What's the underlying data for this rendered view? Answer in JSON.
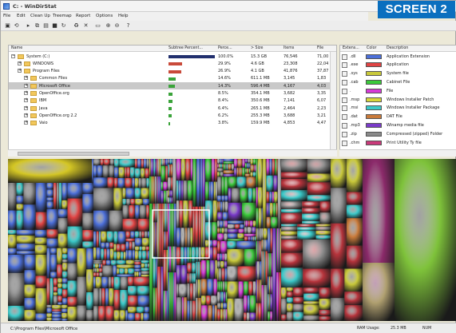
{
  "title": "C: - WinDirStat",
  "badge": "SCREEN 2",
  "menu": [
    "File",
    "Edit",
    "Clean Up",
    "Treemap",
    "Report",
    "Options",
    "Help"
  ],
  "tree": {
    "headers": [
      "Name",
      "Subtree Percent...",
      "Perce...",
      "> Size",
      "Items",
      "File"
    ],
    "rows": [
      {
        "name": "System (C:)",
        "pct": "",
        "perc": "100.0%",
        "size": "15.3 GB",
        "items": "76,546",
        "files": "71,00",
        "level": 0,
        "fill": 1.0,
        "color": "#22306e",
        "selected": false
      },
      {
        "name": "WINDOWS",
        "pct": "",
        "perc": "29.9%",
        "size": "4.6 GB",
        "items": "23,308",
        "files": "22,04",
        "level": 1,
        "fill": 0.3,
        "color": "#c94a3a",
        "selected": false
      },
      {
        "name": "Program Files",
        "pct": "",
        "perc": "26.9%",
        "size": "4.1 GB",
        "items": "41,876",
        "files": "37,87",
        "level": 1,
        "fill": 0.27,
        "color": "#c94a3a",
        "selected": false
      },
      {
        "name": "Common Files",
        "pct": "",
        "perc": "14.6%",
        "size": "611.1 MB",
        "items": "3,145",
        "files": "1,83",
        "level": 2,
        "fill": 0.15,
        "color": "#3aa33a",
        "selected": false
      },
      {
        "name": "Microsoft Office",
        "pct": "",
        "perc": "14.3%",
        "size": "596.4 MB",
        "items": "4,167",
        "files": "4,03",
        "level": 2,
        "fill": 0.14,
        "color": "#3aa33a",
        "selected": true
      },
      {
        "name": "OpenOffice.org",
        "pct": "",
        "perc": "8.5%",
        "size": "354.1 MB",
        "items": "3,682",
        "files": "3,35",
        "level": 2,
        "fill": 0.085,
        "color": "#3aa33a",
        "selected": false
      },
      {
        "name": "IBM",
        "pct": "",
        "perc": "8.4%",
        "size": "350.6 MB",
        "items": "7,141",
        "files": "6,07",
        "level": 2,
        "fill": 0.084,
        "color": "#3aa33a",
        "selected": false
      },
      {
        "name": "Java",
        "pct": "",
        "perc": "6.4%",
        "size": "265.1 MB",
        "items": "2,464",
        "files": "2,23",
        "level": 2,
        "fill": 0.064,
        "color": "#3aa33a",
        "selected": false
      },
      {
        "name": "OpenOffice.org 2.2",
        "pct": "",
        "perc": "6.2%",
        "size": "255.3 MB",
        "items": "3,688",
        "files": "3,21",
        "level": 2,
        "fill": 0.062,
        "color": "#3aa33a",
        "selected": false
      },
      {
        "name": "Vaio",
        "pct": "",
        "perc": "3.8%",
        "size": "159.9 MB",
        "items": "4,853",
        "files": "4,47",
        "level": 2,
        "fill": 0.038,
        "color": "#3aa33a",
        "selected": false
      }
    ]
  },
  "extensions": {
    "headers": [
      "Extens...",
      "Color",
      "Description"
    ],
    "rows": [
      {
        "ext": ".dll",
        "color": "#4c6fd9",
        "desc": "Application Extension"
      },
      {
        "ext": ".exe",
        "color": "#e04343",
        "desc": "Application"
      },
      {
        "ext": ".sys",
        "color": "#c9c93a",
        "desc": "System file"
      },
      {
        "ext": ".cab",
        "color": "#3ac93a",
        "desc": "Cabinet File"
      },
      {
        "ext": ".",
        "color": "#d63ad6",
        "desc": "File"
      },
      {
        "ext": ".msp",
        "color": "#d6d63a",
        "desc": "Windows Installer Patch"
      },
      {
        "ext": ".msi",
        "color": "#3ac9c9",
        "desc": "Windows Installer Package"
      },
      {
        "ext": ".dat",
        "color": "#c97a3a",
        "desc": "DAT File"
      },
      {
        "ext": ".mp3",
        "color": "#7a3ac9",
        "desc": "Winamp media file"
      },
      {
        "ext": ".zip",
        "color": "#8a8a8a",
        "desc": "Compressed (zipped) Folder"
      },
      {
        "ext": ".chm",
        "color": "#c93a7a",
        "desc": "Print Utility Ty file"
      }
    ]
  },
  "status": {
    "path": "C:\\Program Files\\Microsoft Office",
    "ram_label": "RAM Usage:",
    "ram_value": "25.3 MB",
    "num": "NUM"
  }
}
